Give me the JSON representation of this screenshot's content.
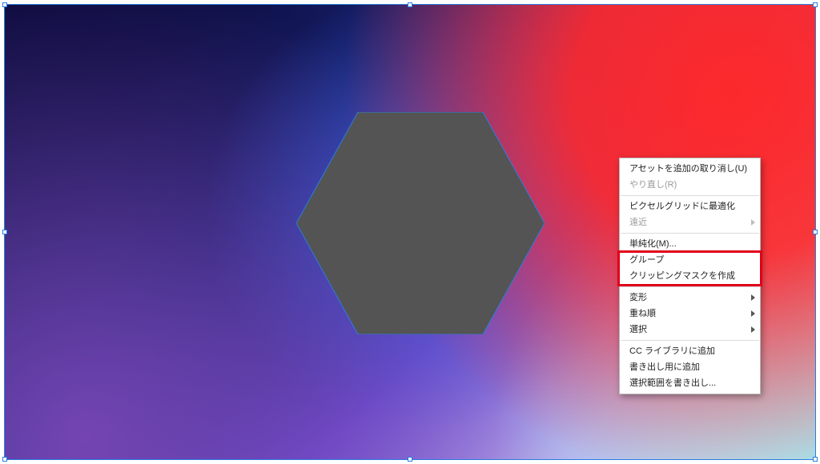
{
  "canvas": {
    "hexagon": {
      "fill": "#545454",
      "stroke": "#2a7de1"
    }
  },
  "context_menu": {
    "highlight_index": 6,
    "items": [
      {
        "label": "アセットを追加の取り消し(U)",
        "enabled": true,
        "submenu": false
      },
      {
        "label": "やり直し(R)",
        "enabled": false,
        "submenu": false
      },
      {
        "sep": true
      },
      {
        "label": "ピクセルグリッドに最適化",
        "enabled": true,
        "submenu": false
      },
      {
        "label": "遠近",
        "enabled": false,
        "submenu": true
      },
      {
        "sep": true
      },
      {
        "label": "単純化(M)...",
        "enabled": true,
        "submenu": false
      },
      {
        "label": "グループ",
        "enabled": true,
        "submenu": false
      },
      {
        "label": "クリッピングマスクを作成",
        "enabled": true,
        "submenu": false
      },
      {
        "sep": true
      },
      {
        "label": "変形",
        "enabled": true,
        "submenu": true
      },
      {
        "label": "重ね順",
        "enabled": true,
        "submenu": true
      },
      {
        "label": "選択",
        "enabled": true,
        "submenu": true
      },
      {
        "sep": true
      },
      {
        "label": "CC ライブラリに追加",
        "enabled": true,
        "submenu": false
      },
      {
        "label": "書き出し用に追加",
        "enabled": true,
        "submenu": false
      },
      {
        "label": "選択範囲を書き出し...",
        "enabled": true,
        "submenu": false
      }
    ]
  }
}
